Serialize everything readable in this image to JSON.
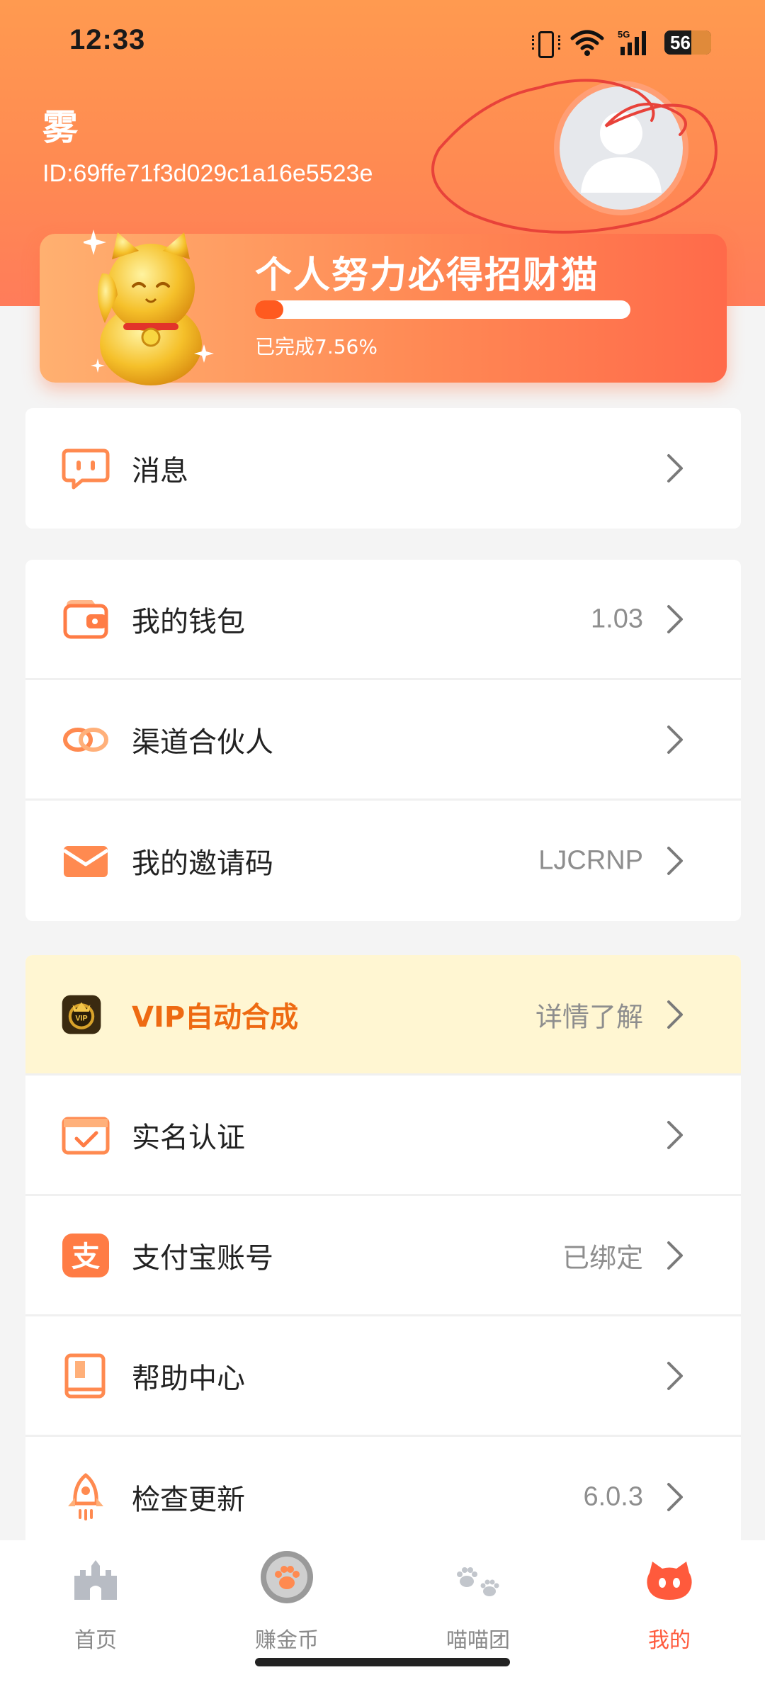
{
  "status_bar": {
    "time": "12:33",
    "network": "5G",
    "battery": "56"
  },
  "profile": {
    "name": "雾",
    "id": "ID:69ffe71f3d029c1a16e5523e"
  },
  "banner": {
    "title": "个人努力必得招财猫",
    "progress_percent": 7.56,
    "progress_text": "已完成7.56%"
  },
  "menu": {
    "messages": {
      "label": "消息",
      "icon": "message-icon"
    },
    "wallet": {
      "label": "我的钱包",
      "value": "1.03",
      "icon": "wallet-icon"
    },
    "partner": {
      "label": "渠道合伙人",
      "icon": "link-icon"
    },
    "invite_code": {
      "label": "我的邀请码",
      "value": "LJCRNP",
      "icon": "envelope-icon"
    },
    "vip": {
      "label": "VIP自动合成",
      "value": "详情了解",
      "icon": "vip-crown-icon"
    },
    "real_name": {
      "label": "实名认证",
      "icon": "verified-card-icon"
    },
    "alipay": {
      "label": "支付宝账号",
      "value": "已绑定",
      "icon": "alipay-icon"
    },
    "help": {
      "label": "帮助中心",
      "icon": "book-icon"
    },
    "update": {
      "label": "检查更新",
      "value": "6.0.3",
      "icon": "rocket-icon"
    }
  },
  "bottom_nav": [
    {
      "label": "首页",
      "icon": "castle-icon",
      "active": false
    },
    {
      "label": "赚金币",
      "icon": "paw-coin-icon",
      "active": false
    },
    {
      "label": "喵喵团",
      "icon": "paws-icon",
      "active": false
    },
    {
      "label": "我的",
      "icon": "cat-face-icon",
      "active": true
    }
  ],
  "colors": {
    "accent": "#ff7c45",
    "active_tab": "#ff5a3c",
    "vip_text": "#ee6a12",
    "vip_bg": "#fff6d2"
  }
}
